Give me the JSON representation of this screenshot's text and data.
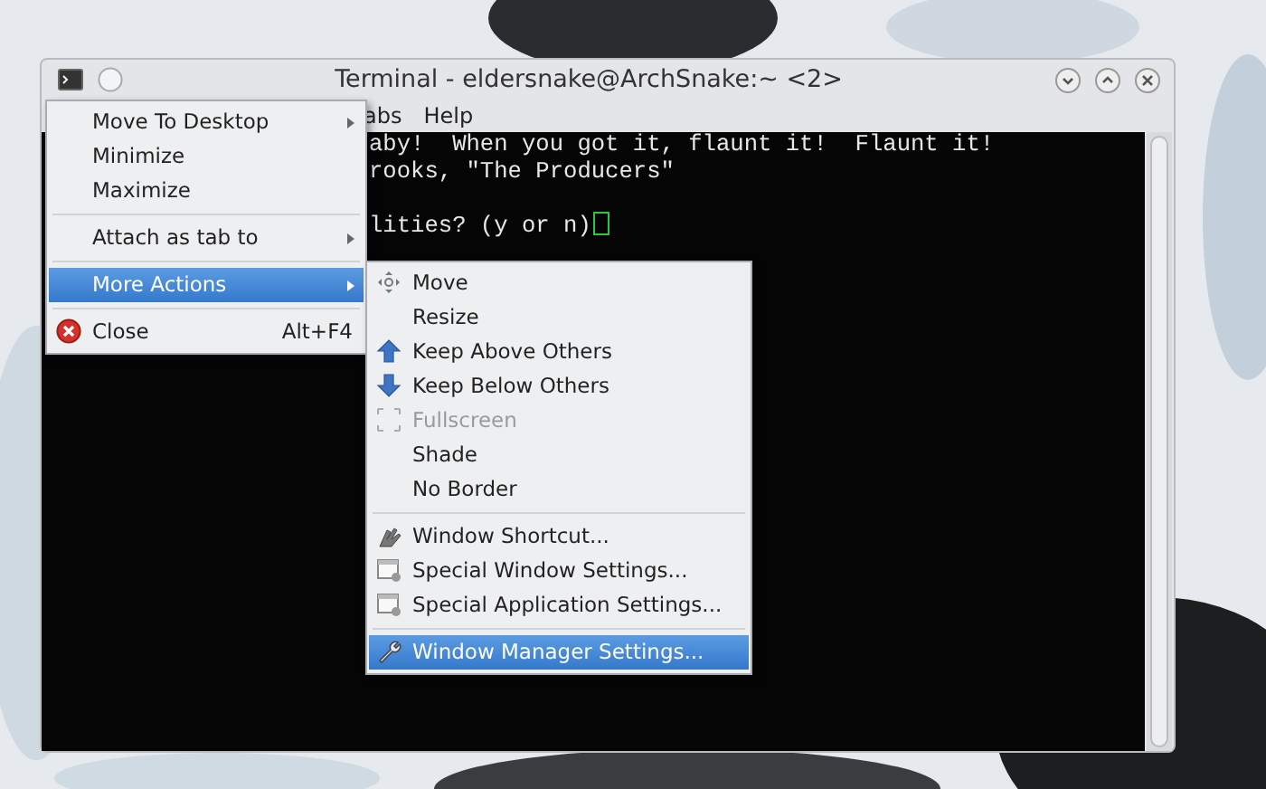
{
  "window": {
    "title": "Terminal - eldersnake@ArchSnake:~ <2>"
  },
  "menu_bar": [
    "abs",
    "Help"
  ],
  "terminal_lines": [
    "aby!  When you got it, flaunt it!  Flaunt it!",
    "rooks, \"The Producers\"",
    "lities? (y or n)"
  ],
  "window_menu": [
    {
      "kind": "submenu",
      "label": "Move To Desktop",
      "selected": false
    },
    {
      "kind": "plain",
      "label": "Minimize",
      "selected": false
    },
    {
      "kind": "plain",
      "label": "Maximize",
      "selected": false
    },
    {
      "kind": "separator"
    },
    {
      "kind": "submenu",
      "label": "Attach as tab to",
      "selected": false
    },
    {
      "kind": "separator"
    },
    {
      "kind": "submenu",
      "label": "More Actions",
      "selected": true
    },
    {
      "kind": "separator"
    },
    {
      "kind": "close",
      "label": "Close",
      "shortcut": "Alt+F4",
      "selected": false
    }
  ],
  "more_actions_menu": [
    {
      "kind": "move",
      "label": "Move",
      "selected": false,
      "disabled": false
    },
    {
      "kind": "plain",
      "label": "Resize",
      "selected": false,
      "disabled": false
    },
    {
      "kind": "up",
      "label": "Keep Above Others",
      "selected": false,
      "disabled": false
    },
    {
      "kind": "down",
      "label": "Keep Below Others",
      "selected": false,
      "disabled": false
    },
    {
      "kind": "fullscreen",
      "label": "Fullscreen",
      "selected": false,
      "disabled": true
    },
    {
      "kind": "plain",
      "label": "Shade",
      "selected": false,
      "disabled": false
    },
    {
      "kind": "plain",
      "label": "No Border",
      "selected": false,
      "disabled": false
    },
    {
      "kind": "separator"
    },
    {
      "kind": "shortcut",
      "label": "Window Shortcut...",
      "selected": false,
      "disabled": false
    },
    {
      "kind": "settings",
      "label": "Special Window Settings...",
      "selected": false,
      "disabled": false
    },
    {
      "kind": "settings",
      "label": "Special Application Settings...",
      "selected": false,
      "disabled": false
    },
    {
      "kind": "separator"
    },
    {
      "kind": "wrench",
      "label": "Window Manager Settings...",
      "selected": true,
      "disabled": false
    }
  ]
}
